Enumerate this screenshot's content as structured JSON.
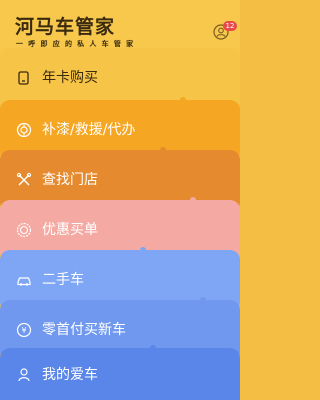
{
  "header": {
    "title": "河马车管家",
    "slogan": "一 呼 即 应 的 私 人 车 管 家",
    "badge_count": "12",
    "background": "#f7c84b"
  },
  "menu": [
    {
      "label": "年卡购买",
      "icon": "card-icon",
      "color": "#f6c548",
      "text_color": "#3a2a10"
    },
    {
      "label": "补漆/救援/代办",
      "icon": "tire-icon",
      "color": "#f5a623",
      "text_color": "#ffffff"
    },
    {
      "label": "查找门店",
      "icon": "tools-icon",
      "color": "#e58a2e",
      "text_color": "#ffffff"
    },
    {
      "label": "优惠买单",
      "icon": "discount-icon",
      "color": "#f4a9a3",
      "text_color": "#ffffff"
    },
    {
      "label": "二手车",
      "icon": "car-icon",
      "color": "#7ea6f4",
      "text_color": "#ffffff"
    },
    {
      "label": "零首付买新车",
      "icon": "new-car-icon",
      "color": "#6f98ee",
      "text_color": "#ffffff"
    },
    {
      "label": "我的爱车",
      "icon": "driver-icon",
      "color": "#5a86ea",
      "text_color": "#ffffff"
    }
  ]
}
